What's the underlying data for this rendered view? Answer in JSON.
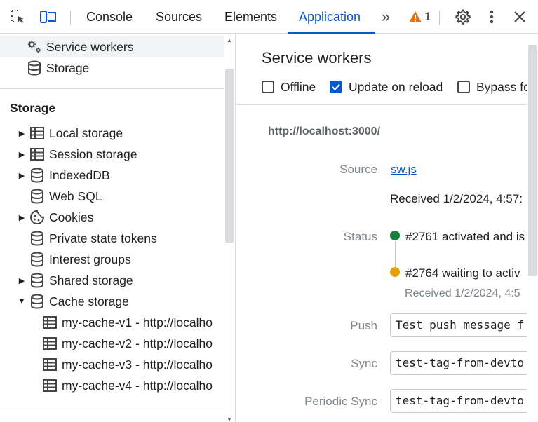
{
  "toolbar": {
    "tabs": [
      "Console",
      "Sources",
      "Elements",
      "Application"
    ],
    "active_tab": "Application",
    "warning_count": "1",
    "more_tabs_glyph": "»"
  },
  "sidebar": {
    "top_items": [
      {
        "label": "Service workers",
        "icon": "gears-icon",
        "selected": true
      },
      {
        "label": "Storage",
        "icon": "database-icon"
      }
    ],
    "storage_title": "Storage",
    "storage_items": [
      {
        "label": "Local storage",
        "icon": "table-icon",
        "expandable": true
      },
      {
        "label": "Session storage",
        "icon": "table-icon",
        "expandable": true
      },
      {
        "label": "IndexedDB",
        "icon": "database-icon",
        "expandable": true
      },
      {
        "label": "Web SQL",
        "icon": "database-icon",
        "expandable": false
      },
      {
        "label": "Cookies",
        "icon": "cookie-icon",
        "expandable": true
      },
      {
        "label": "Private state tokens",
        "icon": "database-icon",
        "expandable": false
      },
      {
        "label": "Interest groups",
        "icon": "database-icon",
        "expandable": false
      },
      {
        "label": "Shared storage",
        "icon": "database-icon",
        "expandable": true
      },
      {
        "label": "Cache storage",
        "icon": "database-icon",
        "expandable": true,
        "expanded": true
      }
    ],
    "cache_items": [
      "my-cache-v1 - http://localho",
      "my-cache-v2 - http://localho",
      "my-cache-v3 - http://localho",
      "my-cache-v4 - http://localho"
    ]
  },
  "main": {
    "title": "Service workers",
    "options": [
      {
        "label": "Offline",
        "checked": false
      },
      {
        "label": "Update on reload",
        "checked": true
      },
      {
        "label": "Bypass fo",
        "checked": false
      }
    ],
    "origin": "http://localhost:3000/",
    "source_label": "Source",
    "source_link": "sw.js",
    "source_received": "Received 1/2/2024, 4:57:",
    "status_label": "Status",
    "status_active": "#2761 activated and is",
    "status_waiting": "#2764 waiting to activ",
    "status_waiting_received": "Received 1/2/2024, 4:5",
    "push_label": "Push",
    "push_value": "Test push message f",
    "sync_label": "Sync",
    "sync_value": "test-tag-from-devto",
    "periodic_sync_label": "Periodic Sync",
    "periodic_sync_value": "test-tag-from-devto"
  },
  "colors": {
    "accent": "#0b57d0",
    "active_status": "#188038",
    "waiting_status": "#e3a008",
    "warning": "#e8710a"
  }
}
